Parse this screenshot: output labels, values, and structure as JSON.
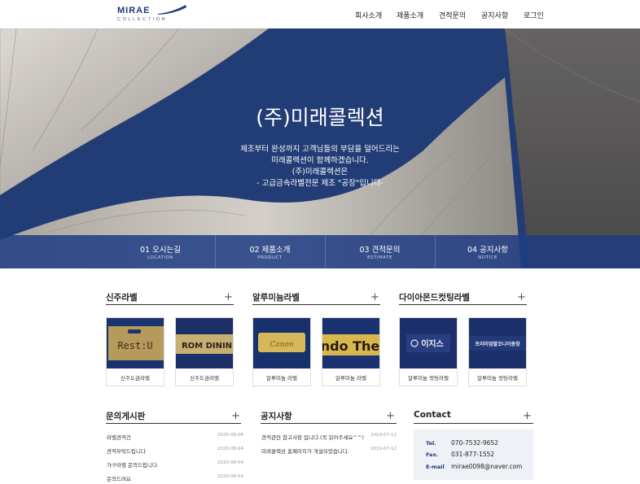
{
  "header": {
    "logo_main": "MIRAE",
    "logo_sub": "COLLECTION",
    "nav": [
      "회사소개",
      "제품소개",
      "견적문의",
      "공지사항",
      "로그인"
    ]
  },
  "hero": {
    "title": "(주)미래콜렉션",
    "lines": [
      "제조부터 완성까지 고객님들의 부담을 덜어드리는",
      "미래콜렉션이 함께하겠습니다.",
      "(주)미래콜렉션은",
      "- 고급금속라벨전문 제조 \"공장\"입니다-"
    ]
  },
  "quick_links": [
    {
      "title": "01 오시는길",
      "sub": "LOCATION"
    },
    {
      "title": "02 제품소개",
      "sub": "PRODUCT"
    },
    {
      "title": "03 견적문의",
      "sub": "ESTIMATE"
    },
    {
      "title": "04 공지사항",
      "sub": "NOTICE"
    }
  ],
  "products": [
    {
      "title": "신주라벨",
      "items": [
        {
          "caption": "신주도금라벨",
          "img_text": "Rest:U"
        },
        {
          "caption": "신주도금라벨",
          "img_text": "ROM DININ"
        }
      ]
    },
    {
      "title": "알루미늄라벨",
      "items": [
        {
          "caption": "알루미늄 라벨",
          "img_text": "Canon"
        },
        {
          "caption": "알루미늄 라벨",
          "img_text": "ndo The"
        }
      ]
    },
    {
      "title": "다이아몬드컷팅라벨",
      "items": [
        {
          "caption": "알루미늄 컷팅라벨",
          "img_text": "이지스"
        },
        {
          "caption": "알루미늄 컷팅라벨",
          "img_text": "프리미엄발코니이중창"
        }
      ]
    }
  ],
  "board": {
    "title": "문의게시판",
    "rows": [
      {
        "text": "라벨견적건",
        "date": "2020-08-06"
      },
      {
        "text": "견적부탁드립니다",
        "date": "2020-08-04"
      },
      {
        "text": "가구라벨 문의드립니다.",
        "date": "2020-08-04"
      },
      {
        "text": "문의드려요",
        "date": "2020-08-04"
      }
    ]
  },
  "notice": {
    "title": "공지사항",
    "rows": [
      {
        "text": "견적관련 참고사항 입니다.(꼭 읽어주세요^^)",
        "date": "2019-07-12"
      },
      {
        "text": "미래콜렉션 홈페이지가 개설되었습니다.",
        "date": "2019-07-12"
      }
    ]
  },
  "contact": {
    "title": "Contact",
    "rows": [
      {
        "label": "Tel.",
        "value": "070-7532-9652"
      },
      {
        "label": "Fax.",
        "value": "031-877-1552"
      },
      {
        "label": "E-mail",
        "value": "mirae0098@naver.com"
      }
    ]
  },
  "colors": {
    "brand": "#1e3a78",
    "hero_blue": "#25427f",
    "quick_bar": "#1e3c82"
  }
}
